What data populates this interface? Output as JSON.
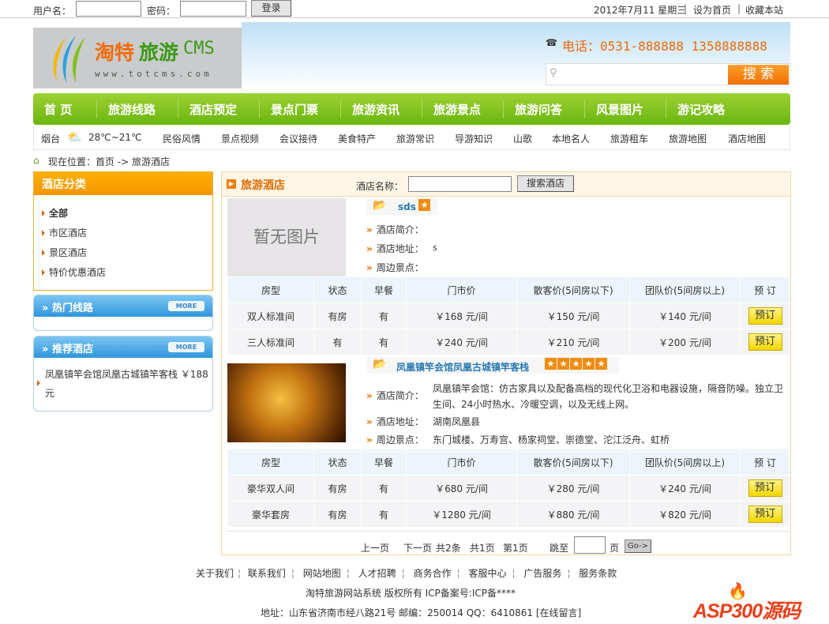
{
  "topbar": {
    "username_label": "用户名：",
    "password_label": "密码：",
    "login_button": "登录",
    "date": "2012年7月11 星期三",
    "set_home": "设为首页",
    "bookmark": "收藏本站",
    "sep": "|"
  },
  "header": {
    "logo_title_a": "淘特",
    "logo_title_b": "旅游",
    "logo_title_c": "CMS",
    "logo_url": "www.totcms.com",
    "phone": "电话：0531-888888 1358888888",
    "search_button": "搜 索",
    "search_placeholder": ""
  },
  "nav": [
    "首 页",
    "旅游线路",
    "酒店预定",
    "景点门票",
    "旅游资讯",
    "旅游景点",
    "旅游问答",
    "风景图片",
    "游记攻略"
  ],
  "subnav": {
    "city": "烟台",
    "weather": "28℃~21℃",
    "items": [
      "民俗风情",
      "景点视频",
      "会议接待",
      "美食特产",
      "旅游常识",
      "导游知识",
      "山歌",
      "本地名人",
      "旅游租车",
      "旅游地图",
      "酒店地图"
    ]
  },
  "breadcrumb": "现在位置：首页 -> 旅游酒店",
  "sidebar": {
    "category_title": "酒店分类",
    "categories": [
      "全部",
      "市区酒店",
      "景区酒店",
      "特价优惠酒店"
    ],
    "hot_title": "热门线路",
    "rec_title": "推荐酒店",
    "more": "MORE",
    "rec_item": "凤凰镇竿会馆凤凰古城镇竿客栈 ￥188元"
  },
  "main": {
    "title": "旅游酒店",
    "search_label": "酒店名称：",
    "search_button": "搜索酒店",
    "labels": {
      "intro": "酒店简介：",
      "address": "酒店地址：",
      "nearby": "周边景点："
    },
    "headers": [
      "房型",
      "状态",
      "早餐",
      "门市价",
      "散客价(5间房以下)",
      "团队价(5间房以上)",
      "预 订"
    ],
    "book": "预订",
    "hotels": [
      {
        "name": "sds",
        "stars": 1,
        "image": "暂无图片",
        "intro": "",
        "address": "s",
        "nearby": "",
        "rooms": [
          [
            "双人标准间",
            "有房",
            "有",
            "￥168 元/间",
            "￥150 元/间",
            "￥140 元/间"
          ],
          [
            "三人标准间",
            "有",
            "有",
            "￥240 元/间",
            "￥210 元/间",
            "￥200 元/间"
          ]
        ]
      },
      {
        "name": "凤凰镇竿会馆凤凰古城镇竿客栈",
        "stars": 5,
        "image": "",
        "intro": "凤凰镇竿会馆：仿古家具以及配备高档的现代化卫浴和电器设施，隔音防噪。独立卫生间、24小时热水、冷暖空调，以及无线上网。",
        "address": "湖南凤凰县",
        "nearby": "东门城楼、万寿宫、杨家祠堂、崇德堂、沱江泛舟、虹桥",
        "rooms": [
          [
            "豪华双人间",
            "有房",
            "有",
            "￥680 元/间",
            "￥280 元/间",
            "￥240 元/间"
          ],
          [
            "豪华套房",
            "有房",
            "有",
            "￥1280 元/间",
            "￥880 元/间",
            "￥820 元/间"
          ]
        ]
      }
    ],
    "pager": {
      "prev": "上一页",
      "next": "下一页",
      "total": "共2条",
      "pages": "共1页",
      "current": "第1页",
      "jump": "跳至",
      "page_unit": "页",
      "go": "Go->"
    }
  },
  "footer": {
    "links": [
      "关于我们",
      "联系我们",
      "网站地图",
      "人才招聘",
      "商务合作",
      "客服中心",
      "广告服务",
      "服务条款"
    ],
    "copyright": "淘特旅游网站系统 版权所有 ICP备案号:ICP备****",
    "address": "地址：山东省济南市经八路21号 邮编：250014 QQ：6410861 [在线留言]",
    "badge": "ASP300源码"
  }
}
